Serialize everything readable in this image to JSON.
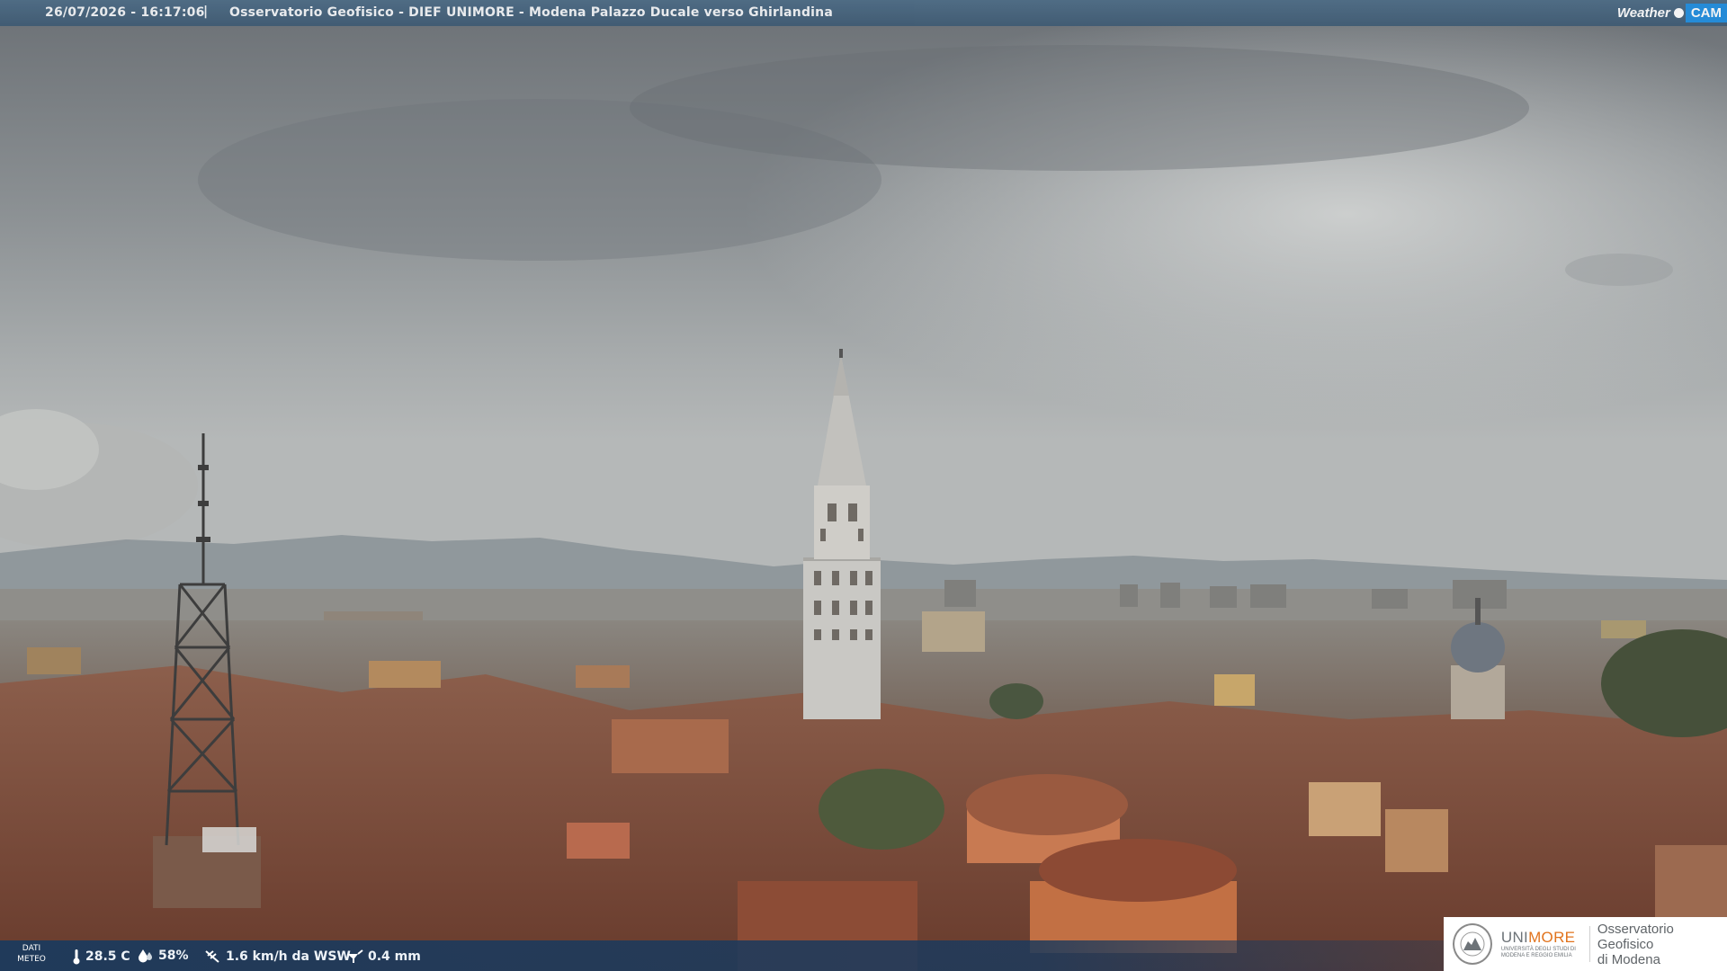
{
  "topbar": {
    "datetime": "26/07/2026 - 16:17:06",
    "separator": "|",
    "title": "Osservatorio Geofisico - DIEF UNIMORE - Modena Palazzo Ducale verso Ghirlandina"
  },
  "logo_weathercam": {
    "left": "Weather",
    "right": "CAM"
  },
  "meteo": {
    "label_line1": "DATI",
    "label_line2": "METEO",
    "temperature": "28.5 C",
    "humidity": "58%",
    "wind": "1.6 km/h da WSW",
    "rain": "0.4 mm"
  },
  "unimore": {
    "brand_a": "UNI",
    "brand_b": "MORE",
    "subtitle": "UNIVERSITÀ DEGLI STUDI DI MODENA E REGGIO EMILIA",
    "obs_line1": "Osservatorio Geofisico",
    "obs_line2": "di Modena"
  },
  "colors": {
    "topbar": "#466480",
    "bottombar": "#1c3a5c",
    "unimore_orange": "#e1731d",
    "weathercam_blue": "#1f8ee0"
  }
}
